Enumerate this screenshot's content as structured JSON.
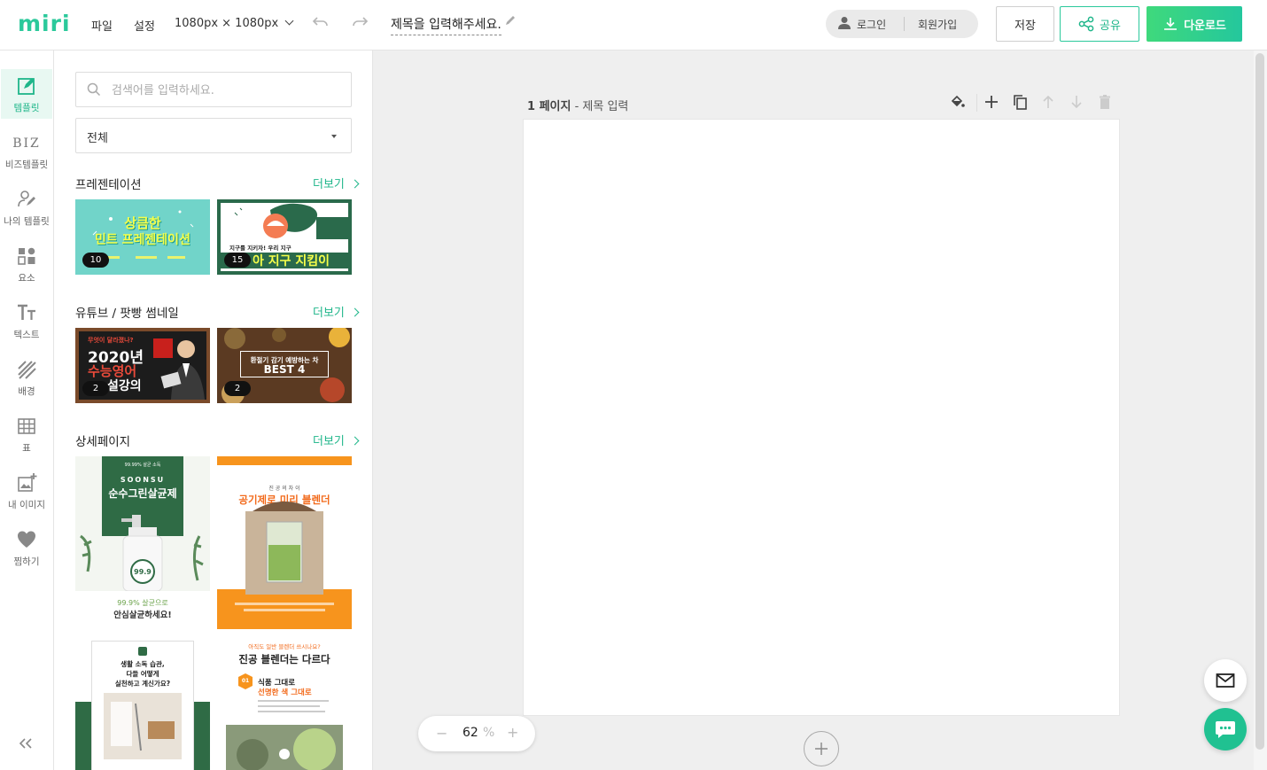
{
  "header": {
    "logo": "miri",
    "menu": [
      "파일",
      "설정"
    ],
    "size": "1080px × 1080px",
    "title": "제목을 입력해주세요.",
    "login": "로그인",
    "join": "회원가입",
    "save": "저장",
    "share": "공유",
    "download": "다운로드"
  },
  "nav": [
    {
      "label": "템플릿",
      "icon": "template-edit-icon",
      "active": true
    },
    {
      "label": "비즈템플릿",
      "icon": "biz-icon"
    },
    {
      "label": "나의 템플릿",
      "icon": "my-template-icon"
    },
    {
      "label": "요소",
      "icon": "elements-icon"
    },
    {
      "label": "텍스트",
      "icon": "text-icon"
    },
    {
      "label": "배경",
      "icon": "background-icon"
    },
    {
      "label": "표",
      "icon": "table-icon"
    },
    {
      "label": "내 이미지",
      "icon": "my-image-icon"
    },
    {
      "label": "찜하기",
      "icon": "heart-icon"
    }
  ],
  "biz_icon_text": "BIZ",
  "panel": {
    "search_placeholder": "검색어를 입력하세요.",
    "filter": "전체",
    "more": "더보기",
    "sections": [
      {
        "title": "프레젠테이션",
        "items": [
          {
            "count": "10",
            "line1": "상큼한",
            "line2": "민트 프레젠테이션"
          },
          {
            "count": "15",
            "headline": "지구를 지키자! 우리 지구",
            "line": "아 지구 지킴이"
          }
        ]
      },
      {
        "title": "유튜브 / 팟빵 썸네일",
        "items": [
          {
            "count": "2",
            "top": "무엇이 달라졌나?",
            "line1": "2020년",
            "line2": "수능영어",
            "line3": "설강의"
          },
          {
            "count": "2",
            "line1": "환절기 감기 예방하는 차",
            "line2": "BEST 4"
          }
        ]
      },
      {
        "title": "상세페이지",
        "items": [
          {
            "small": "99.99% 살균 소독",
            "brand": "SOONSU",
            "name": "순수그린살균제",
            "pct": "99.9",
            "caption1": "99.9% 살균으로",
            "caption2": "안심살균하세요!"
          },
          {
            "small": "진 공 의 차 이",
            "name": "공기제로 미리 블렌더"
          },
          {
            "line1": "생활 소독 습관,",
            "line2": "다들 어떻게",
            "line3": "실천하고 계신가요?"
          },
          {
            "small": "아직도 일반 블렌더 쓰시나요?",
            "headline": "진공 블렌더는 다르다",
            "tag": "01",
            "sub1": "식품 그대로",
            "sub2": "선명한 색 그대로"
          }
        ]
      }
    ]
  },
  "canvas": {
    "page_num": "1 페이지",
    "page_title": "제목 입력",
    "zoom": "62",
    "zoom_unit": "%"
  },
  "colors": {
    "brand": "#2bc99b",
    "brand_dark": "#1fb68a"
  }
}
